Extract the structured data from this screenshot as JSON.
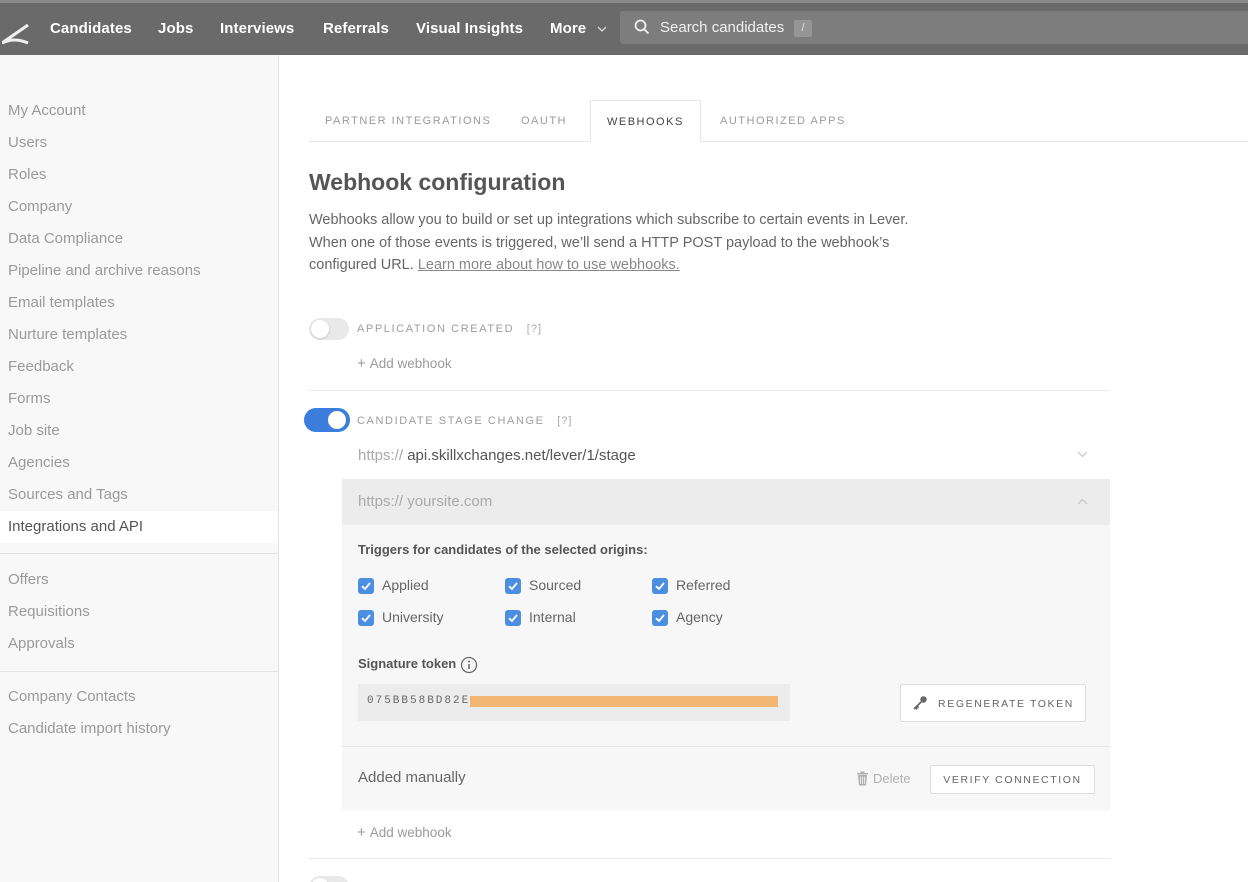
{
  "nav": {
    "items": [
      "Candidates",
      "Jobs",
      "Interviews",
      "Referrals",
      "Visual Insights",
      "More"
    ],
    "search_placeholder": "Search candidates",
    "search_shortcut": "/"
  },
  "sidebar": {
    "group1": [
      "My Account",
      "Users",
      "Roles",
      "Company",
      "Data Compliance",
      "Pipeline and archive reasons",
      "Email templates",
      "Nurture templates",
      "Feedback",
      "Forms",
      "Job site",
      "Agencies",
      "Sources and Tags",
      "Integrations and API"
    ],
    "group2": [
      "Offers",
      "Requisitions",
      "Approvals"
    ],
    "group3": [
      "Company Contacts",
      "Candidate import history"
    ]
  },
  "tabs": [
    "PARTNER INTEGRATIONS",
    "OAUTH",
    "WEBHOOKS",
    "AUTHORIZED APPS"
  ],
  "content": {
    "title": "Webhook configuration",
    "description": "Webhooks allow you to build or set up integrations which subscribe to certain events in Lever. When one of those events is triggered, we’ll send a HTTP POST payload to the webhook’s configured URL.",
    "learn_more": "Learn more about how to use webhooks."
  },
  "events": {
    "application_created": {
      "label": "APPLICATION CREATED",
      "help": "[?]",
      "add": "Add webhook"
    },
    "candidate_stage_change": {
      "label": "CANDIDATE STAGE CHANGE",
      "help": "[?]",
      "add": "Add webhook"
    }
  },
  "webhooks": {
    "url1_proto": "https://",
    "url1_host": "api.skillxchanges.net/lever/1/stage",
    "url2_placeholder": "https:// yoursite.com"
  },
  "triggers": {
    "title": "Triggers for candidates of the selected origins:",
    "options": [
      "Applied",
      "Sourced",
      "Referred",
      "University",
      "Internal",
      "Agency"
    ]
  },
  "signature": {
    "title": "Signature token",
    "token_visible": "075BB58BD82E",
    "regenerate": "REGENERATE TOKEN"
  },
  "footer": {
    "added_manually": "Added manually",
    "delete": "Delete",
    "verify": "VERIFY CONNECTION"
  },
  "colors": {
    "accent": "#3b7ddd",
    "checkbox": "#4a8fe0",
    "redaction": "#f2b572",
    "nav_bg": "#6a6a6a"
  }
}
